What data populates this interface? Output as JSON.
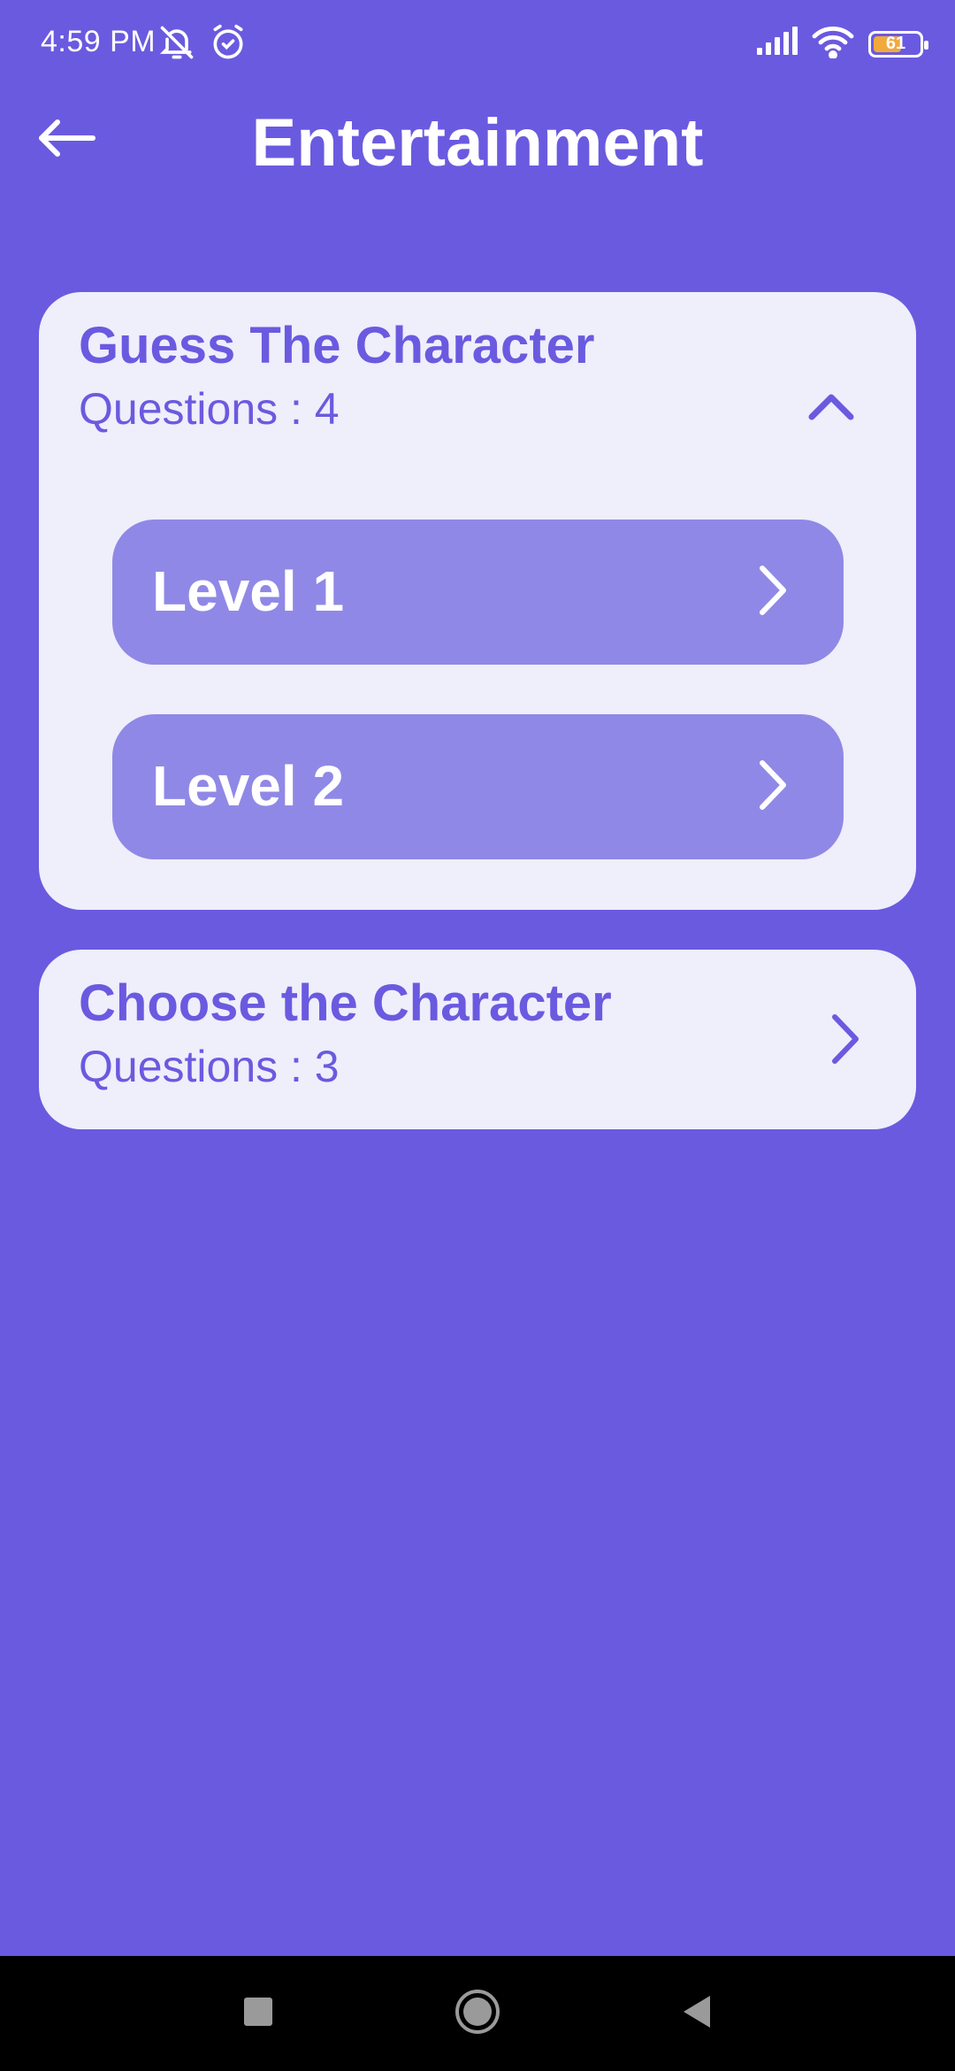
{
  "status_bar": {
    "time": "4:59 PM",
    "battery_level": "61",
    "battery_fraction": 0.61,
    "icons": [
      "bell-off-icon",
      "alarm-icon",
      "signal-icon",
      "wifi-icon",
      "battery-icon"
    ]
  },
  "header": {
    "title": "Entertainment",
    "back_icon": "arrow-left-icon"
  },
  "categories": [
    {
      "title": "Guess The Character",
      "questions": "Questions : 4",
      "expanded": true,
      "levels": [
        {
          "label": "Level 1"
        },
        {
          "label": "Level 2"
        }
      ]
    },
    {
      "title": "Choose the Character",
      "questions": "Questions : 3",
      "expanded": false
    }
  ],
  "nav_bar": {
    "icons": [
      "recents-square-icon",
      "home-circle-icon",
      "back-triangle-icon"
    ]
  },
  "colors": {
    "background": "#6a5ae0",
    "card": "#efeefb",
    "level_button": "#9088e6",
    "accent_text": "#6a5ae0",
    "battery": "#f2a93b"
  }
}
